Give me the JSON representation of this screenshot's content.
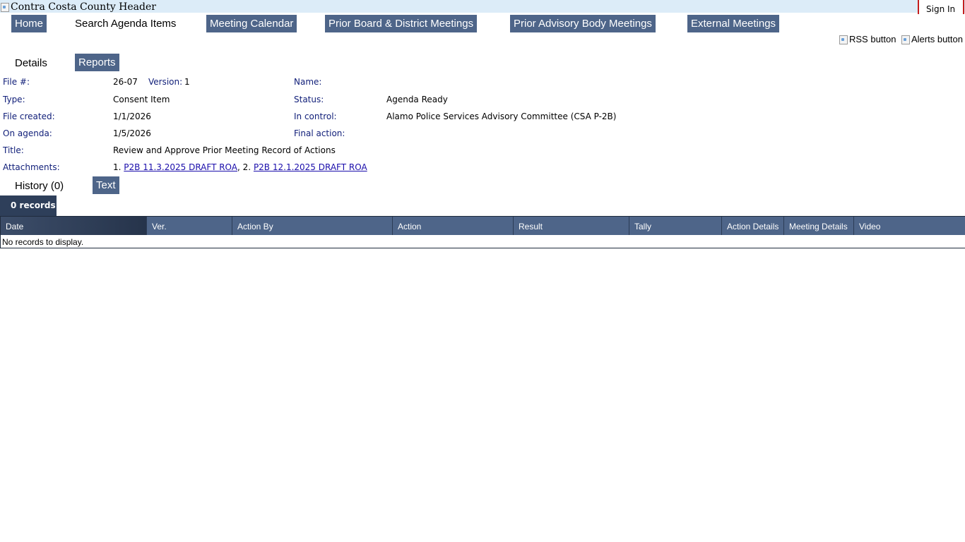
{
  "header": {
    "image_alt": "Contra Costa County Header",
    "sign_in": "Sign In"
  },
  "nav": {
    "home": "Home",
    "search": "Search Agenda Items",
    "calendar": "Meeting Calendar",
    "prior_board": "Prior Board & District Meetings",
    "prior_advisory": "Prior Advisory Body Meetings",
    "external": "External Meetings"
  },
  "feeds": {
    "rss_alt": "RSS button",
    "alerts_alt": "Alerts button"
  },
  "tabs": {
    "details": "Details",
    "reports": "Reports",
    "history": "History (0)",
    "text": "Text"
  },
  "details": {
    "file_label": "File #:",
    "file_value": "26-07",
    "version_label": "Version:",
    "version_value": "1",
    "name_label": "Name:",
    "type_label": "Type:",
    "type_value": "Consent Item",
    "status_label": "Status:",
    "status_value": "Agenda Ready",
    "created_label": "File created:",
    "created_value": "1/1/2026",
    "control_label": "In control:",
    "control_value": "Alamo Police Services Advisory Committee (CSA P-2B)",
    "agenda_label": "On agenda:",
    "agenda_value": "1/5/2026",
    "final_label": "Final action:",
    "title_label": "Title:",
    "title_value": "Review and Approve Prior Meeting Record of Actions",
    "attachments_label": "Attachments:",
    "attachments": [
      {
        "num": "1.",
        "label": "P2B 11.3.2025 DRAFT ROA"
      },
      {
        "num": "2.",
        "label": "P2B 12.1.2025 DRAFT ROA"
      }
    ]
  },
  "history": {
    "records_label": "0 records",
    "columns": [
      "Date",
      "Ver.",
      "Action By",
      "Action",
      "Result",
      "Tally",
      "Action Details",
      "Meeting Details",
      "Video"
    ],
    "empty_message": "No records to display."
  },
  "colors": {
    "nav_bg": "#4e6589",
    "header_bg": "#dcecf8",
    "label_text": "#12207a",
    "link": "#1a0dab",
    "signin_border": "#c41e1e"
  }
}
